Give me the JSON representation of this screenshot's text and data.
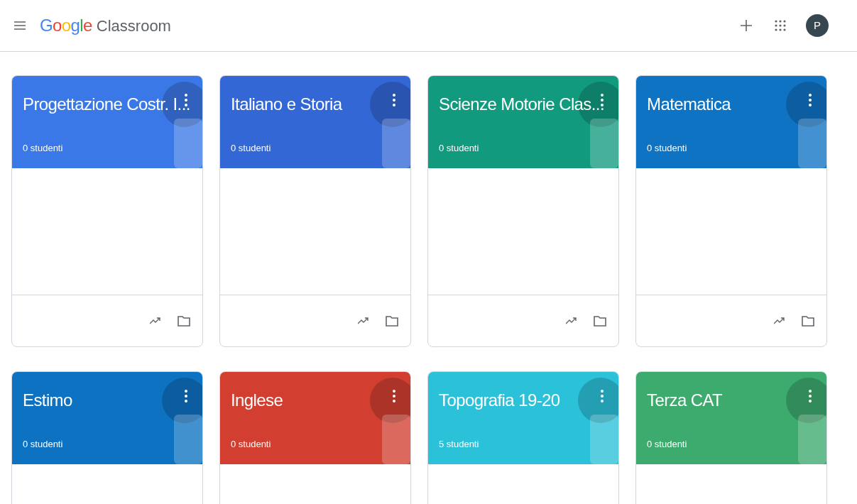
{
  "app_bar": {
    "logo_brand": "Google",
    "logo_product": "Classroom",
    "avatar_letter": "P"
  },
  "classes": [
    {
      "name": "Progettazione Costr. I...",
      "students": "0 studenti",
      "color": "#3b78e7"
    },
    {
      "name": "Italiano e Storia",
      "students": "0 studenti",
      "color": "#3367d6"
    },
    {
      "name": "Scienze Motorie Clas...",
      "students": "0 studenti",
      "color": "#129a7f"
    },
    {
      "name": "Matematica",
      "students": "0 studenti",
      "color": "#0f73c4"
    },
    {
      "name": "Estimo",
      "students": "0 studenti",
      "color": "#0e72c2"
    },
    {
      "name": "Inglese",
      "students": "0 studenti",
      "color": "#d23f31"
    },
    {
      "name": "Topografia 19-20",
      "students": "5 studenti",
      "color": "#2bc1d9"
    },
    {
      "name": "Terza CAT",
      "students": "0 studenti",
      "color": "#3daa6e"
    }
  ]
}
